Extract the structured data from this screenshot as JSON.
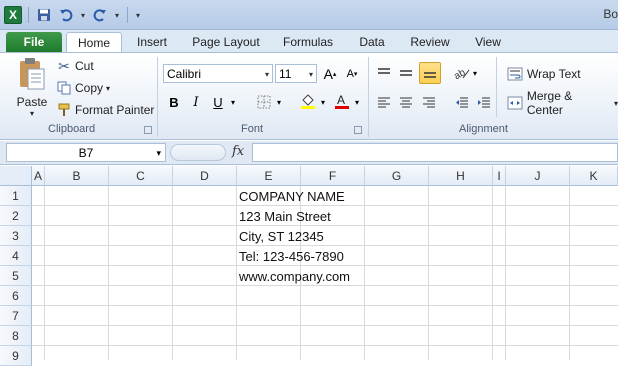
{
  "title": "Bo",
  "qat": {
    "app_logo": "X"
  },
  "tabs": [
    {
      "label": "File",
      "active": false
    },
    {
      "label": "Home",
      "active": true
    },
    {
      "label": "Insert"
    },
    {
      "label": "Page Layout"
    },
    {
      "label": "Formulas"
    },
    {
      "label": "Data"
    },
    {
      "label": "Review"
    },
    {
      "label": "View"
    }
  ],
  "ribbon": {
    "clipboard": {
      "label": "Clipboard",
      "paste": "Paste",
      "cut": "Cut",
      "copy": "Copy",
      "format_painter": "Format Painter"
    },
    "font": {
      "label": "Font",
      "name": "Calibri",
      "size": "11",
      "bold": "B",
      "italic": "I",
      "underline": "U",
      "grow": "A",
      "shrink": "A"
    },
    "alignment": {
      "label": "Alignment",
      "wrap_text": "Wrap Text",
      "merge_center": "Merge & Center"
    }
  },
  "formula_bar": {
    "name_box": "B7",
    "fx": "fx",
    "value": ""
  },
  "columns": [
    "A",
    "B",
    "C",
    "D",
    "E",
    "F",
    "G",
    "H",
    "I",
    "J",
    "K"
  ],
  "rows": [
    "1",
    "2",
    "3",
    "4",
    "5",
    "6",
    "7",
    "8",
    "9"
  ],
  "cells": {
    "E1": "COMPANY NAME",
    "E2": "123 Main Street",
    "E3": "City, ST 12345",
    "E4": "Tel: 123-456-7890",
    "E5": "www.company.com"
  },
  "colors": {
    "file_tab": "#1f7a2e",
    "selected_align": "#fbcf55",
    "highlight": "#ffff00",
    "font_color": "#e00000"
  }
}
